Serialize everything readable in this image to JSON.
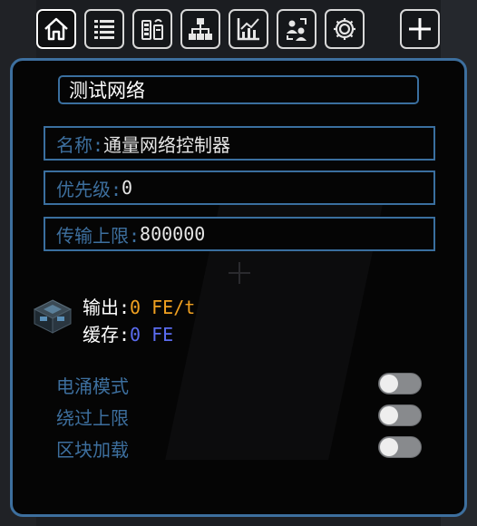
{
  "tabs": [
    {
      "name": "home",
      "icon": "home-icon",
      "active": true
    },
    {
      "name": "list",
      "icon": "list-icon",
      "active": false
    },
    {
      "name": "devices",
      "icon": "battery-devices-icon",
      "active": false
    },
    {
      "name": "network",
      "icon": "network-tree-icon",
      "active": false
    },
    {
      "name": "statistics",
      "icon": "line-chart-icon",
      "active": false
    },
    {
      "name": "members",
      "icon": "users-swap-icon",
      "active": false
    },
    {
      "name": "settings",
      "icon": "gear-icon",
      "active": false
    },
    {
      "name": "add",
      "icon": "plus-icon",
      "active": false
    }
  ],
  "network_name": "测试网络",
  "fields": {
    "name_label": "名称:",
    "name_value": "通量网络控制器",
    "priority_label": "优先级:",
    "priority_value": "0",
    "limit_label": "传输上限:",
    "limit_value": "800000"
  },
  "stats": {
    "output_label": "输出:",
    "output_value": "0 FE/t",
    "buffer_label": "缓存:",
    "buffer_value": "0 FE"
  },
  "options": [
    {
      "label": "电涌模式",
      "enabled": false
    },
    {
      "label": "绕过上限",
      "enabled": false
    },
    {
      "label": "区块加载",
      "enabled": false
    }
  ],
  "colors": {
    "accent": "#3d6f9e",
    "output_value": "#f0a020",
    "buffer_value": "#5b6cf0",
    "text": "#ffffff"
  }
}
